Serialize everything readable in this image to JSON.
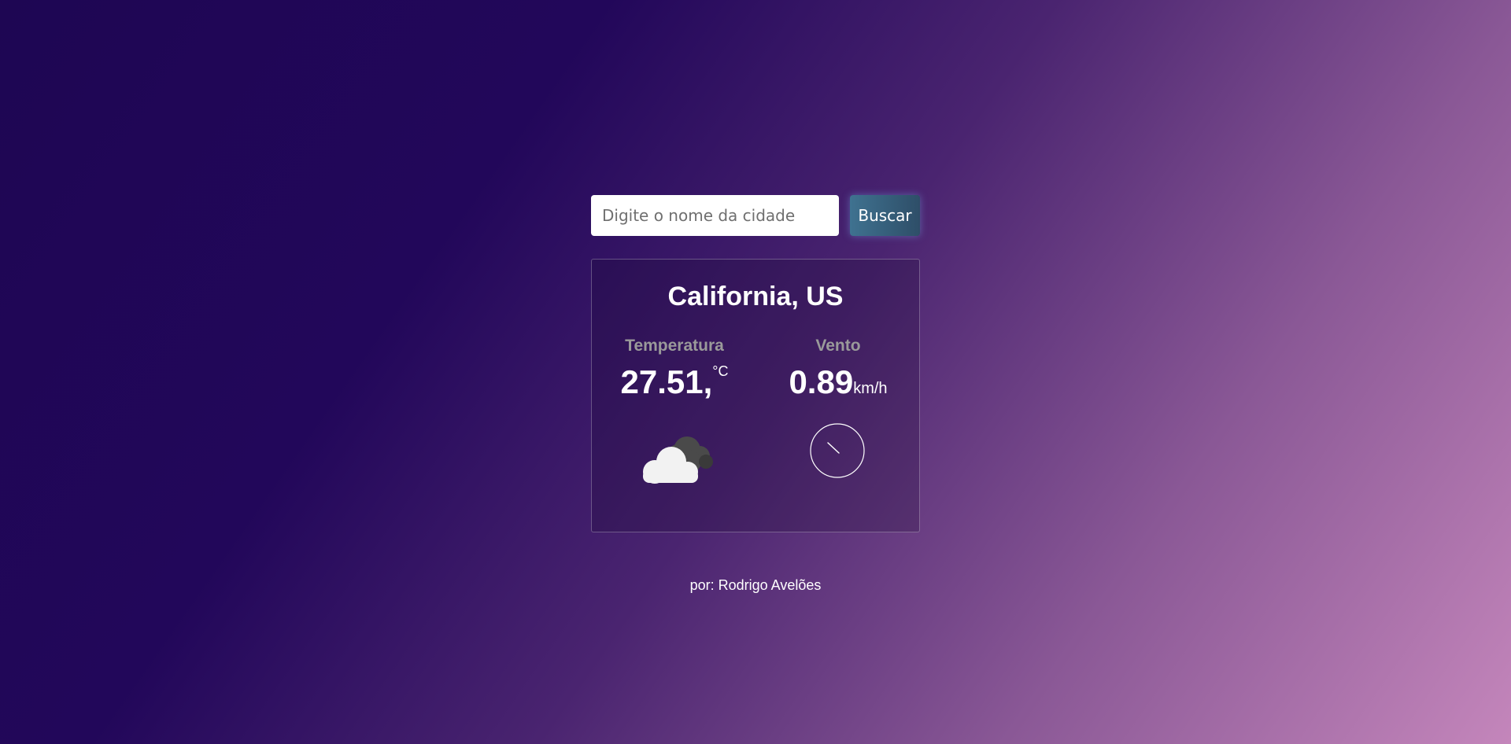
{
  "search": {
    "placeholder": "Digite o nome da cidade",
    "value": "",
    "button_label": "Buscar"
  },
  "weather": {
    "city": "California, US",
    "temperature": {
      "label": "Temperatura",
      "value": "27.51,",
      "unit": "°C"
    },
    "wind": {
      "label": "Vento",
      "value": "0.89",
      "unit": "km/h"
    },
    "condition_icon": "cloud-icon",
    "wind_direction_icon": "wind-direction-icon"
  },
  "footer": {
    "credit": "por: Rodrigo Avelões"
  },
  "colors": {
    "gradient_start": "#1e0653",
    "gradient_end": "#c486bb",
    "button_start": "#3f7290",
    "button_end": "#2e4e68",
    "label_gray": "#9a9a9a"
  }
}
